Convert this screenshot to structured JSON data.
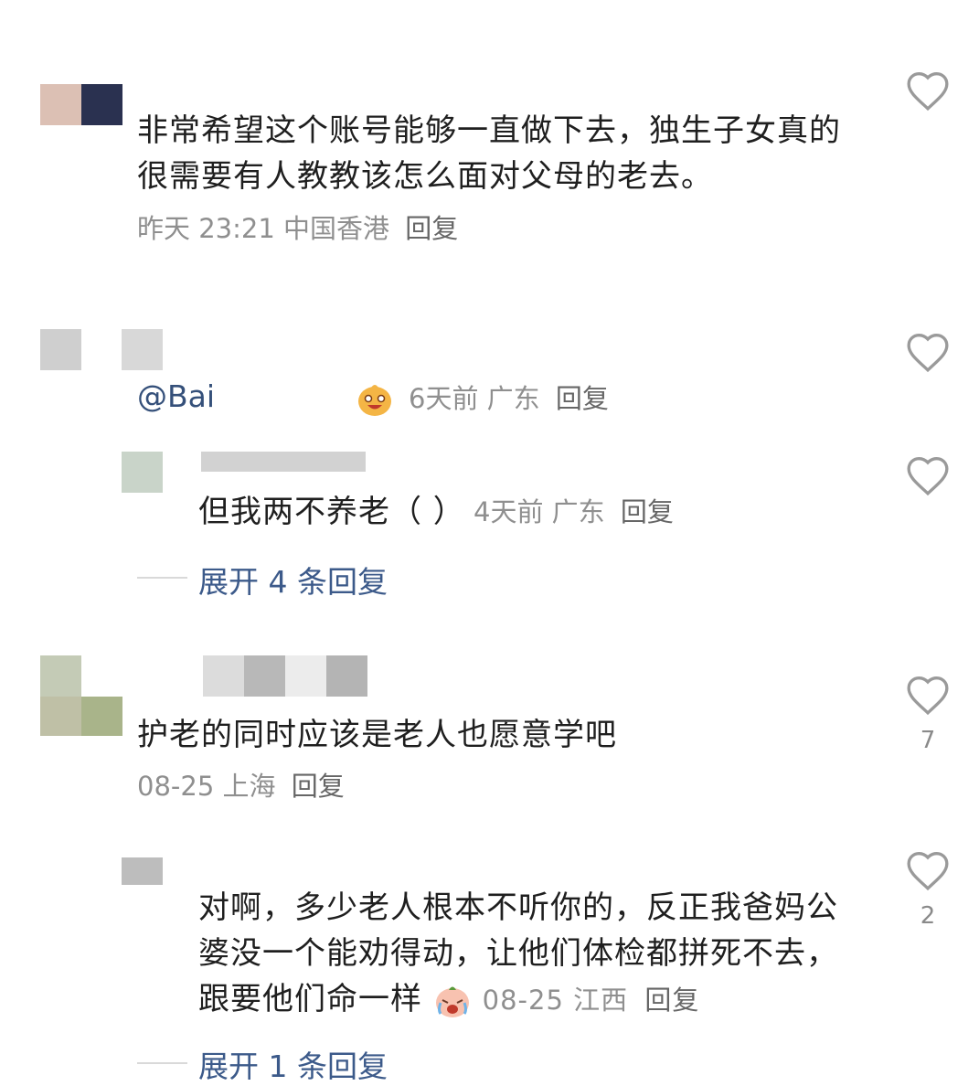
{
  "comments": [
    {
      "text": "非常希望这个账号能够一直做下去，独生子女真的很需要有人教教该怎么面对父母的老去。",
      "time": "昨天 23:21",
      "location": "中国香港",
      "reply": "回复",
      "likes": ""
    },
    {
      "mention": "@Bai",
      "time": "6天前",
      "location": "广东",
      "reply": "回复",
      "emoji": "laughing-emoji",
      "sub_reply": {
        "text": "但我两不养老（ ）",
        "time": "4天前",
        "location": "广东",
        "reply": "回复"
      },
      "expand": "展开 4 条回复"
    },
    {
      "text": "护老的同时应该是老人也愿意学吧",
      "time": "08-25",
      "location": "上海",
      "reply": "回复",
      "likes": "7",
      "sub_reply": {
        "text": "对啊，多少老人根本不听你的，反正我爸妈公婆没一个能劝得动，让他们体检都拼死不去，跟要他们命一样",
        "time": "08-25",
        "location": "江西",
        "reply": "回复",
        "likes": "2",
        "emoji": "crying-emoji"
      },
      "expand": "展开 1 条回复"
    }
  ],
  "colors": {
    "text": "#1f1f1f",
    "meta": "#8f8f8f",
    "link": "#3c5a8a",
    "heart": "#9a9a9a"
  }
}
